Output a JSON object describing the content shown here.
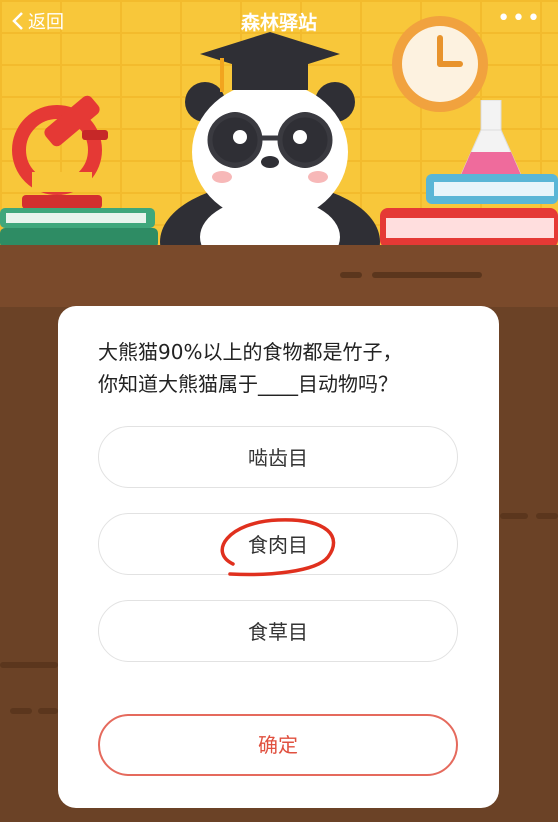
{
  "nav": {
    "back_label": "返回",
    "title": "森林驿站",
    "more_label": "•••"
  },
  "quiz": {
    "question_line1": "大熊猫90%以上的食物都是竹子，",
    "question_line2": "你知道大熊猫属于____目动物吗？",
    "options": [
      {
        "label": "啮齿目"
      },
      {
        "label": "食肉目"
      },
      {
        "label": "食草目"
      }
    ],
    "annotated_option_index": 1,
    "confirm_label": "确定"
  },
  "colors": {
    "wall": "#f8c73a",
    "wood": "#6b4226",
    "accent": "#e0503f",
    "annotation": "#e0301e"
  },
  "icons": [
    "back-chevron-icon",
    "microscope-icon",
    "panda-graduate-icon",
    "clock-icon",
    "flask-icon",
    "books-icon"
  ]
}
